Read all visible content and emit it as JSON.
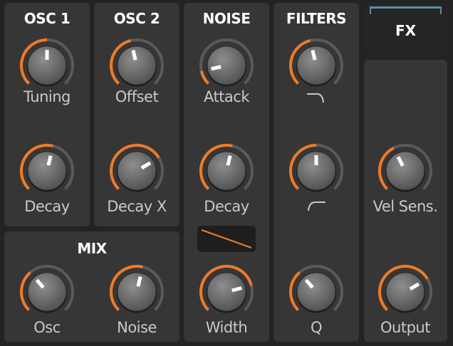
{
  "colors": {
    "accent": "#f07a26",
    "track": "#5a5a5a",
    "panel": "#363636",
    "background": "#232323",
    "fx_outline": "#5f8aa3"
  },
  "sections": {
    "osc1": "OSC 1",
    "osc2": "OSC 2",
    "noise": "NOISE",
    "filters": "FILTERS",
    "mix": "MIX",
    "fx": "FX"
  },
  "knobs": {
    "tuning": {
      "label": "Tuning",
      "value": 0.5
    },
    "offset": {
      "label": "Offset",
      "value": 0.45
    },
    "osc1_decay": {
      "label": "Decay",
      "value": 0.55
    },
    "osc2_decay_x": {
      "label": "Decay X",
      "value": 0.72
    },
    "noise_attack": {
      "label": "Attack",
      "value": 0.12
    },
    "noise_decay": {
      "label": "Decay",
      "value": 0.55
    },
    "noise_width": {
      "label": "Width",
      "value": 0.78
    },
    "filter_lowpass": {
      "label": "",
      "value": 0.45,
      "icon": "lowpass-curve-icon"
    },
    "filter_highpass": {
      "label": "",
      "value": 0.5,
      "icon": "highpass-curve-icon"
    },
    "filter_q": {
      "label": "Q",
      "value": 0.35
    },
    "vel_sens": {
      "label": "Vel Sens.",
      "value": 0.4
    },
    "output": {
      "label": "Output",
      "value": 0.72
    },
    "mix_osc": {
      "label": "Osc",
      "value": 0.35
    },
    "mix_noise": {
      "label": "Noise",
      "value": 0.55
    }
  },
  "envelope_display": {
    "icon": "envelope-slope-icon"
  }
}
